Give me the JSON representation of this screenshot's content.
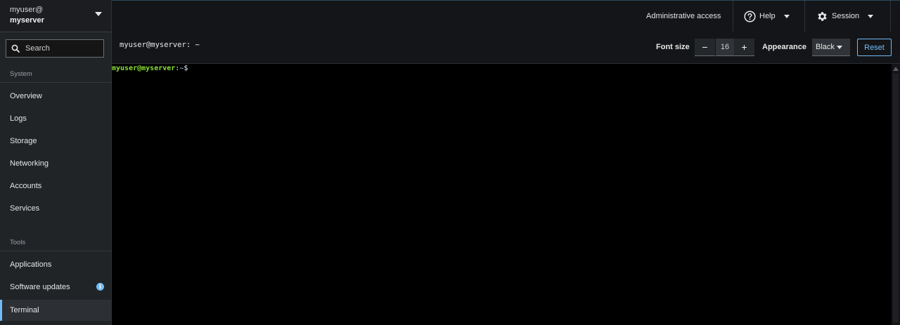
{
  "host": {
    "user": "myuser@",
    "server": "myserver"
  },
  "search": {
    "placeholder": "Search"
  },
  "sidebar": {
    "system_label": "System",
    "system_items": [
      "Overview",
      "Logs",
      "Storage",
      "Networking",
      "Accounts",
      "Services"
    ],
    "tools_label": "Tools",
    "tools_items": [
      "Applications",
      "Software updates",
      "Terminal"
    ],
    "active_item": "Terminal",
    "updates_badge": "i"
  },
  "topbar": {
    "admin_access": "Administrative access",
    "help": "Help",
    "session": "Session"
  },
  "terminal_header": {
    "title": "myuser@myserver: ~",
    "font_size_label": "Font size",
    "font_size_value": "16",
    "minus": "−",
    "plus": "+",
    "appearance_label": "Appearance",
    "appearance_value": "Black",
    "reset": "Reset"
  },
  "terminal": {
    "prompt_user_host": "myuser@myserver",
    "prompt_colon": ":",
    "prompt_path": "~",
    "prompt_symbol": "$"
  },
  "colors": {
    "accent": "#73bcf7",
    "prompt_user": "#8ae234",
    "prompt_path": "#729fcf"
  }
}
